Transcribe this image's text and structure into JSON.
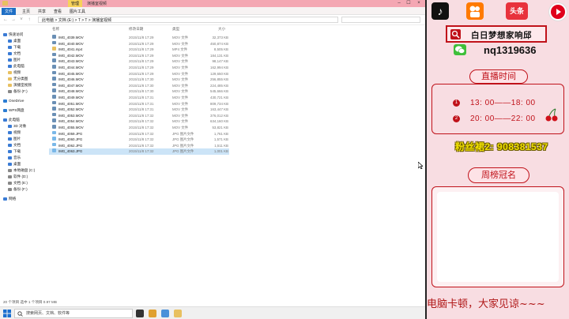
{
  "explorer": {
    "title": "演播室视频",
    "ribbon_tabs": [
      "文件",
      "主页",
      "共享",
      "查看",
      "图片工具"
    ],
    "manage_tab": "管理",
    "address_path": "此电脑 > 文档 (E:) > T > T > 演播室视频",
    "columns": {
      "name": "名称",
      "date": "修改日期",
      "type": "类型",
      "size": "大小"
    },
    "nav_items": [
      {
        "label": "快速访问",
        "color": "#3a7bd5"
      },
      {
        "label": "桌面",
        "color": "#3a7bd5"
      },
      {
        "label": "下载",
        "color": "#3a7bd5"
      },
      {
        "label": "文档",
        "color": "#3a7bd5"
      },
      {
        "label": "图片",
        "color": "#3a7bd5"
      },
      {
        "label": "此电脑",
        "color": "#3a7bd5"
      },
      {
        "label": "视频",
        "color": "#e8c060"
      },
      {
        "label": "无分类图",
        "color": "#e8c060"
      },
      {
        "label": "演播室视频",
        "color": "#e8c060"
      },
      {
        "label": "备份 (F:)",
        "color": "#888888"
      },
      {
        "label": "OneDrive",
        "color": "#2b7cd3"
      },
      {
        "label": "WPS网盘",
        "color": "#2b7cd3"
      },
      {
        "label": "此电脑",
        "color": "#3a7bd5"
      },
      {
        "label": "3D 对象",
        "color": "#3a7bd5"
      },
      {
        "label": "视频",
        "color": "#3a7bd5"
      },
      {
        "label": "图片",
        "color": "#3a7bd5"
      },
      {
        "label": "文档",
        "color": "#3a7bd5"
      },
      {
        "label": "下载",
        "color": "#3a7bd5"
      },
      {
        "label": "音乐",
        "color": "#3a7bd5"
      },
      {
        "label": "桌面",
        "color": "#3a7bd5"
      },
      {
        "label": "本地磁盘 (C:)",
        "color": "#888888"
      },
      {
        "label": "软件 (D:)",
        "color": "#888888"
      },
      {
        "label": "文档 (E:)",
        "color": "#888888"
      },
      {
        "label": "备份 (F:)",
        "color": "#888888"
      },
      {
        "label": "网络",
        "color": "#3a7bd5"
      }
    ],
    "files": [
      {
        "name": "IMG_4039.MOV",
        "date": "2015/11/8 17:29",
        "type": "MOV 文件",
        "size": "32,373 KB",
        "kind": "mov"
      },
      {
        "name": "IMG_4040.MOV",
        "date": "2015/11/8 17:29",
        "type": "MOV 文件",
        "size": "450,874 KB",
        "kind": "mov"
      },
      {
        "name": "IMG_4041.mp4",
        "date": "2015/11/8 17:29",
        "type": "MP4 文件",
        "size": "8,505 KB",
        "kind": "mp4"
      },
      {
        "name": "IMG_4042.MOV",
        "date": "2015/11/8 17:29",
        "type": "MOV 文件",
        "size": "184,131 KB",
        "kind": "mov"
      },
      {
        "name": "IMG_4043.MOV",
        "date": "2015/11/8 17:29",
        "type": "MOV 文件",
        "size": "98,147 KB",
        "kind": "mov"
      },
      {
        "name": "IMG_4044.MOV",
        "date": "2015/11/8 17:29",
        "type": "MOV 文件",
        "size": "162,994 KB",
        "kind": "mov"
      },
      {
        "name": "IMG_4045.MOV",
        "date": "2015/11/8 17:29",
        "type": "MOV 文件",
        "size": "129,650 KB",
        "kind": "mov"
      },
      {
        "name": "IMG_4046.MOV",
        "date": "2015/11/8 17:30",
        "type": "MOV 文件",
        "size": "256,855 KB",
        "kind": "mov"
      },
      {
        "name": "IMG_4047.MOV",
        "date": "2015/11/8 17:30",
        "type": "MOV 文件",
        "size": "224,485 KB",
        "kind": "mov"
      },
      {
        "name": "IMG_4048.MOV",
        "date": "2015/11/8 17:30",
        "type": "MOV 文件",
        "size": "545,666 KB",
        "kind": "mov"
      },
      {
        "name": "IMG_4049.MOV",
        "date": "2015/11/8 17:31",
        "type": "MOV 文件",
        "size": "430,721 KB",
        "kind": "mov"
      },
      {
        "name": "IMG_4051.MOV",
        "date": "2015/11/8 17:31",
        "type": "MOV 文件",
        "size": "809,734 KB",
        "kind": "mov"
      },
      {
        "name": "IMG_4052.MOV",
        "date": "2015/11/8 17:31",
        "type": "MOV 文件",
        "size": "163,447 KB",
        "kind": "mov"
      },
      {
        "name": "IMG_4053.MOV",
        "date": "2015/11/8 17:32",
        "type": "MOV 文件",
        "size": "376,012 KB",
        "kind": "mov"
      },
      {
        "name": "IMG_4054.MOV",
        "date": "2015/11/8 17:32",
        "type": "MOV 文件",
        "size": "634,160 KB",
        "kind": "mov"
      },
      {
        "name": "IMG_4055.MOV",
        "date": "2015/11/8 17:32",
        "type": "MOV 文件",
        "size": "53,821 KB",
        "kind": "mov"
      },
      {
        "name": "IMG_4059.JPG",
        "date": "2015/11/8 17:32",
        "type": "JPG 图片文件",
        "size": "1,761 KB",
        "kind": "jpg"
      },
      {
        "name": "IMG_4060.JPG",
        "date": "2015/11/8 17:32",
        "type": "JPG 图片文件",
        "size": "1,571 KB",
        "kind": "jpg"
      },
      {
        "name": "IMG_4062.JPG",
        "date": "2015/11/8 17:32",
        "type": "JPG 图片文件",
        "size": "1,511 KB",
        "kind": "jpg"
      },
      {
        "name": "IMG_4063.JPG",
        "date": "2015/11/8 17:32",
        "type": "JPG 图片文件",
        "size": "1,001 KB",
        "kind": "jpg",
        "selected": true
      }
    ],
    "status": "20 个项目   选中 1 个项目  0.97 MB"
  },
  "taskbar": {
    "search_placeholder": "搜索网页、文档、软件等"
  },
  "panel": {
    "app_icons": [
      "tiktok-icon",
      "kuaishou-icon",
      "toutiao-icon",
      "youtube-icon"
    ],
    "toutiao_label": "头条",
    "name": "白日梦想家响邱",
    "wechat_id": "nq1319636",
    "schedule_title": "直播时间",
    "schedule": [
      {
        "num": "1",
        "time": "13: 00——18: 00"
      },
      {
        "num": "2",
        "time": "20: 00——22: 00"
      }
    ],
    "fans_group": "粉丝裙2: 908381537",
    "ranking_title": "周榜冠名",
    "footer": "电脑卡顿，大家见谅~~~"
  },
  "colors": {
    "accent_red": "#c0121a",
    "panel_bg": "#f8dde2",
    "title_pink": "#f4a7b3",
    "select_blue": "#cce4f7"
  }
}
